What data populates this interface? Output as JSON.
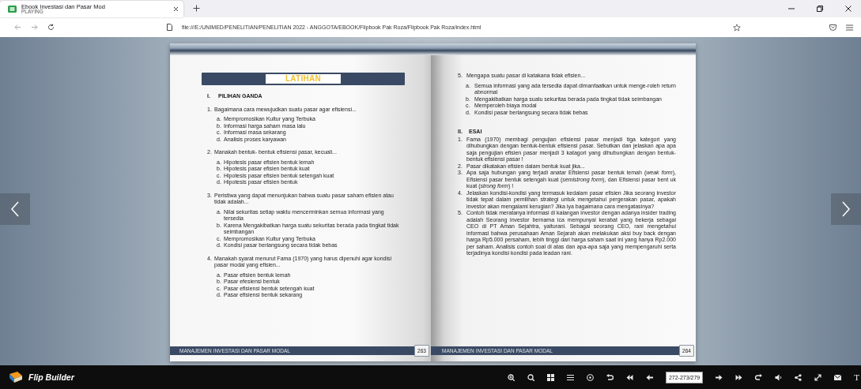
{
  "browser": {
    "tab": {
      "title": "Ebook Investasi dan Pasar Mod",
      "status": "PLAYING",
      "selected": true
    },
    "address": "file:///E:/UNIMED/PENELITIAN/PENELITIAN 2022 - ANGGOTA/EBOOK/Flipbook Pak Roza/Flipbook Pak Roza/index.html"
  },
  "left_page": {
    "heading": "LATIHAN",
    "section": {
      "numeral": "I.",
      "title": "PILIHAN GANDA"
    },
    "questions": [
      {
        "number": "1.",
        "text": "Bagaimana cara mewujudkan suatu pasar agar efisiensi...",
        "options": [
          {
            "letter": "a.",
            "text": "Mempromosikan Kultur yang Terbuka"
          },
          {
            "letter": "b.",
            "text": "Informasi harga saham masa lalu"
          },
          {
            "letter": "c.",
            "text": "Informasi masa sekarang"
          },
          {
            "letter": "d.",
            "text": "Analisis proses karyawan"
          }
        ]
      },
      {
        "number": "2.",
        "text": "Manakah bentuk- bentuk efisiensi pasar, kecuali...",
        "options": [
          {
            "letter": "a.",
            "text": "Hipotesis pasar efisien bentuk lemah"
          },
          {
            "letter": "b.",
            "text": "Hipotesis pasar efisien bentuk kuat"
          },
          {
            "letter": "c.",
            "text": "Hipotesis pasar efisien bentuk setengah kuat"
          },
          {
            "letter": "d.",
            "text": "Hipotesis pasar efisien bentuk"
          }
        ]
      },
      {
        "number": "3.",
        "text": "Peristiwa yang dapat menunjukan bahwa suatu pasar saham efisien atau tidak adalah...",
        "options": [
          {
            "letter": "a.",
            "text": "Nilai sekuritas setiap waktu mencerminkan semua informasi yang tersedia"
          },
          {
            "letter": "b.",
            "text": "Karena Mengakibatkan harga suatu sekuritas berada pada tingkat tidak seimbangan"
          },
          {
            "letter": "c.",
            "text": "Mempromosikan Kultur yang Terbuka"
          },
          {
            "letter": "d.",
            "text": "Kondisi pasar berlangsung secara tidak bebas"
          }
        ]
      },
      {
        "number": "4.",
        "text": "Manakah syarat menurut Fama (1970) yang harus dipenuhi agar kondisi pasar modal yang efisien...",
        "options": [
          {
            "letter": "a.",
            "text": "Pasar efisien bentuk lemah"
          },
          {
            "letter": "b.",
            "text": "Pasar efesiensi bentuk"
          },
          {
            "letter": "c.",
            "text": "Pasar efisiensi bentuk setengah kuat"
          },
          {
            "letter": "d.",
            "text": "Pasar efisiensi bentuk sekarang"
          }
        ]
      }
    ],
    "footer": {
      "title": "MANAJEMEN INVESTASI DAN PASAR MODAL",
      "page": "263"
    }
  },
  "right_page": {
    "questions": [
      {
        "number": "5.",
        "text": "Mengapa suatu pasar di katakana tidak efisien...",
        "options": [
          {
            "letter": "a.",
            "text": "Semua informasi yang ada tersedia dapat dimanfaatkan untuk menge-roleh return abnormal"
          },
          {
            "letter": "b.",
            "text": "Mengakibatkan harga suatu sekuritas berada pada tingkat tidak seimbangan"
          },
          {
            "letter": "c.",
            "text": "Memperoleh biaya modal"
          },
          {
            "letter": "d.",
            "text": "Kondisi pasar berlangsung secara tidak bebas"
          }
        ]
      }
    ],
    "section": {
      "numeral": "II.",
      "title": "ESAI"
    },
    "essays": [
      {
        "number": "1.",
        "text": "Fama (1970) membagi pengujian efisiensi pasar menjadi tiga kategori yang dihubungkan dengan bentuk-bentuk efisiensi pasar. Sebutkan dan jelaskan apa apa saja pengujian efisien pasar menjadi 3 katagori yang dihubungkan dengan bentuk-bentuk efisiensi pasar !"
      },
      {
        "number": "2.",
        "text": "Pasar dikatakan efisien dalam bentuk kuat jika..."
      },
      {
        "number": "3.",
        "text": "Apa saja hubungan yang terjadi anatar Efisiensi pasar bentuk lemah (*weak form*), Efisiensi pasar bentuk setengah kuat (*semistrong form*), dan Efisiensi pasar bent uk kuat (*strong form*) !"
      },
      {
        "number": "4.",
        "text": "Jelaskan kondisi-kondisi yang termasuk kedalam pasar efisien Jika seorang investor tidak tepat dalam pemilihan strategi untuk mengetahui pergerakan pasar, apakah investor akan mengalami kerugian? Jika iya bagaimana cara mengatasinya?"
      },
      {
        "number": "5.",
        "text": "Contoh tidak meratanya informasi di kalangan investor dengan adanya insider trading adalah Seorang investor bernama ica mempunyai kerabat yang bekerja sebagai CEO di PT Aman Sejahtra, yaiturani. Sebagai seorang CEO, rani mengetahui informasi bahwa perusahaan Aman Sejarah akan melakukan aksi buy back dengan harga Rp5.000 persaham, lebih tinggi dari harga saham saat ini yang hanya Rp2.000 per saham. Analisis contoh soal di atas dan apa-apa saja yang mempengaruhi serta terjadinya kondisi kondisi pada leadan rani."
      }
    ],
    "footer": {
      "title": "MANAJEMEN INVESTASI DAN PASAR MODAL",
      "page": "264"
    }
  },
  "toolbar": {
    "brand": "Flip Builder",
    "page_field": "272-273/279",
    "cut_label": "T"
  }
}
